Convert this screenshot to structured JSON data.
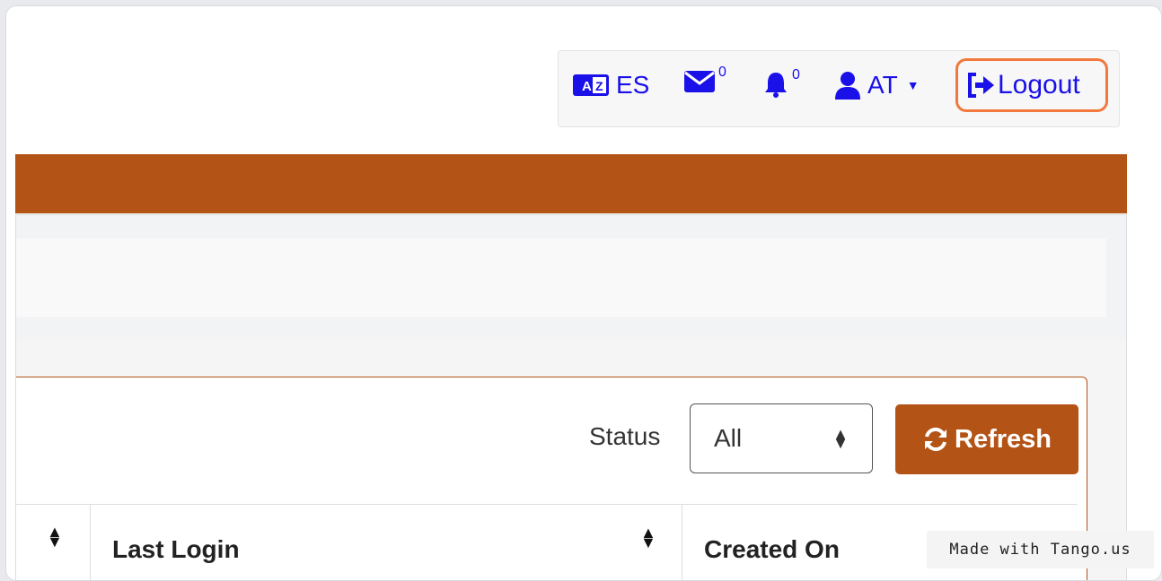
{
  "nav": {
    "language": "ES",
    "messages_count": "0",
    "notifications_count": "0",
    "user_initials": "AT",
    "logout_label": "Logout"
  },
  "filters": {
    "status_label": "Status",
    "status_value": "All",
    "refresh_label": "Refresh"
  },
  "table": {
    "columns": [
      "Last Login",
      "Created On"
    ]
  },
  "watermark": "Made with Tango.us",
  "colors": {
    "brand": "#b35316",
    "link": "#1a10e8",
    "highlight": "#f2783b"
  }
}
